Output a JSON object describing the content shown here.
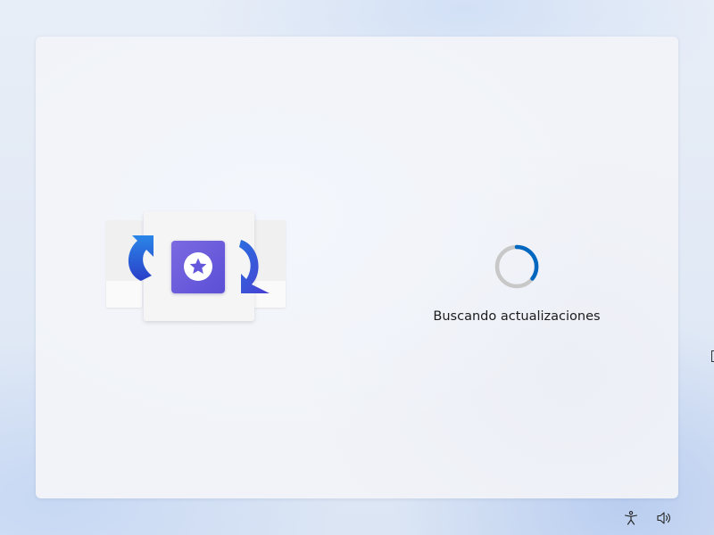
{
  "window": {
    "status_text": "Buscando actualizaciones"
  },
  "icons": {
    "hero": "update-illustration-icon",
    "app": "star-app-icon",
    "spinner": "progress-ring-icon",
    "accessibility": "accessibility-icon",
    "volume": "volume-icon"
  },
  "colors": {
    "accent": "#0067c0",
    "spinner_track": "#c8c8c8",
    "arrow_blue": "#1a5fd8",
    "tile_purple": "#6457dc",
    "card_bg": "#f1f3f8"
  }
}
